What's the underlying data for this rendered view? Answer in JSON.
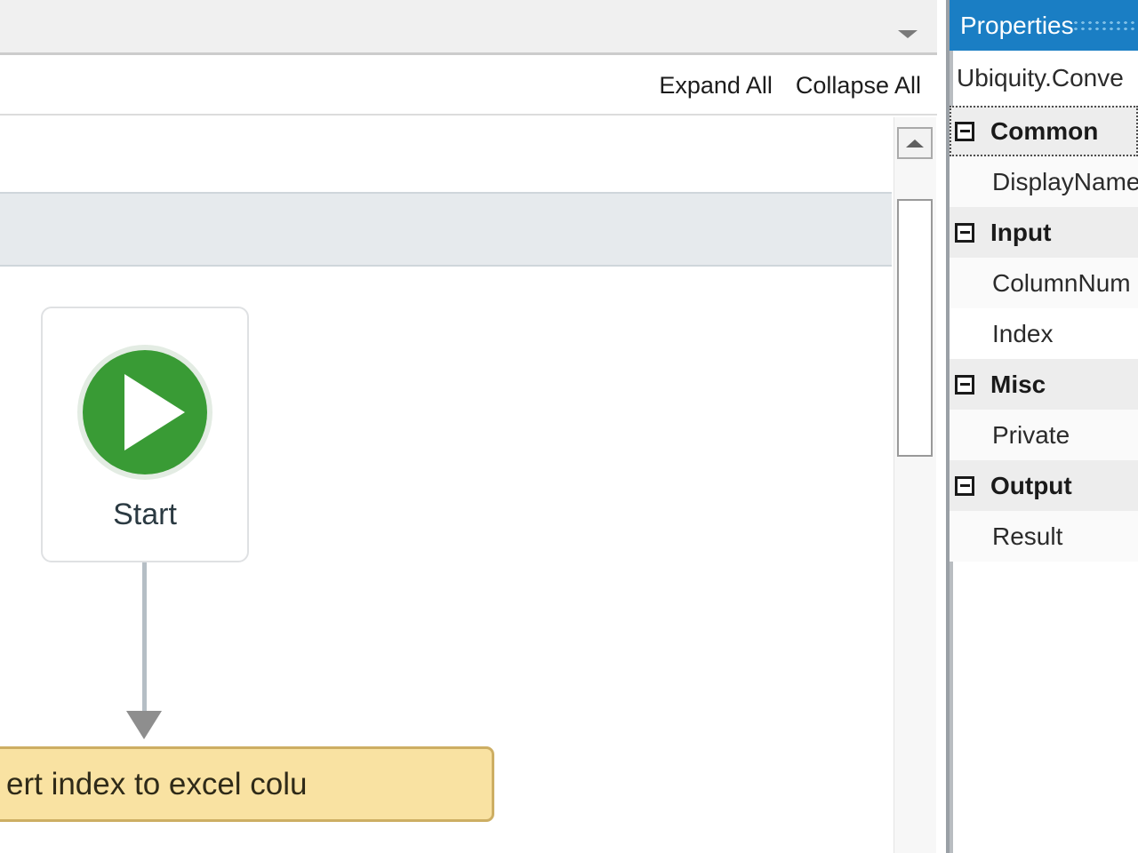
{
  "designer": {
    "toolbar": {
      "expand_all_label": "Expand All",
      "collapse_all_label": "Collapse All",
      "dropdown_icon": "chevron-down-icon"
    },
    "canvas": {
      "start_node": {
        "label": "Start",
        "icon": "play-icon",
        "accent_color": "#399b35"
      },
      "connector": {
        "icon": "arrow-down-icon",
        "line_color": "#b5bec5",
        "arrow_color": "#8e8e8e"
      },
      "activity_node": {
        "label": "ert index to excel colu",
        "fill_color": "#f9e2a2",
        "border_color": "#cdae63"
      }
    },
    "scrollbar": {
      "up_arrow_icon": "scroll-up-icon",
      "thumb_name": "scrollbar-thumb"
    }
  },
  "properties": {
    "header_title": "Properties",
    "grip_icon": "drag-grip-icon",
    "subject": "Ubiquity.Conve",
    "accent_color": "#1a7ec4",
    "groups": [
      {
        "name": "Common",
        "expander_icon": "collapse-box-icon",
        "focused": true,
        "items": [
          {
            "name": "DisplayName",
            "shaded": true
          }
        ]
      },
      {
        "name": "Input",
        "expander_icon": "collapse-box-icon",
        "focused": false,
        "items": [
          {
            "name": "ColumnNum",
            "shaded": true
          },
          {
            "name": "Index",
            "shaded": false
          }
        ]
      },
      {
        "name": "Misc",
        "expander_icon": "collapse-box-icon",
        "focused": false,
        "items": [
          {
            "name": "Private",
            "shaded": true
          }
        ]
      },
      {
        "name": "Output",
        "expander_icon": "collapse-box-icon",
        "focused": false,
        "items": [
          {
            "name": "Result",
            "shaded": true
          }
        ]
      }
    ]
  }
}
